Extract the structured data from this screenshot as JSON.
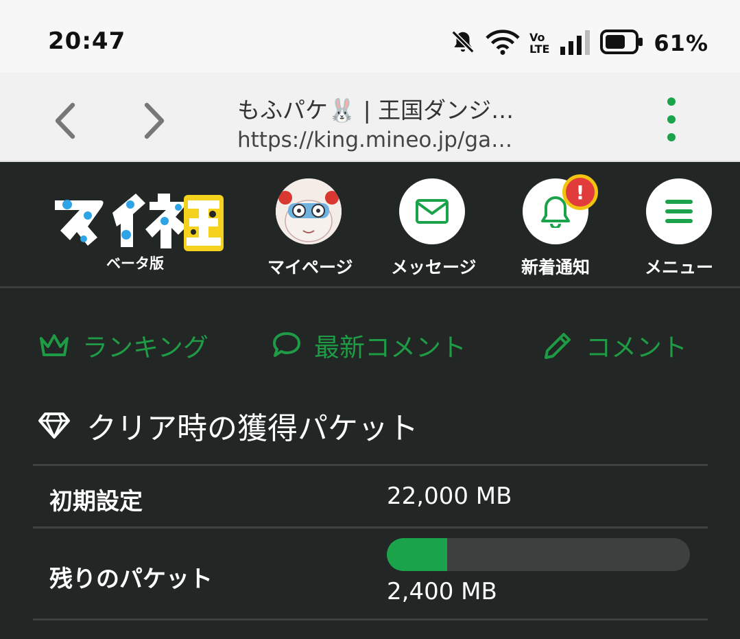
{
  "status_bar": {
    "time": "20:47",
    "volte_top": "Vo",
    "volte_bottom": "LTE",
    "battery_percent": "61%",
    "icons": [
      "bell-off-icon",
      "wifi-icon",
      "volte-icon",
      "signal-icon",
      "battery-icon"
    ]
  },
  "browser": {
    "tab_title": "もふパケ🐰 | 王国ダンジ…",
    "url": "https://king.mineo.jp/ga…",
    "icons": [
      "back-icon",
      "forward-icon",
      "more-menu-icon"
    ]
  },
  "header": {
    "logo_text": "マイネ王",
    "logo_sub": "ベータ版",
    "buttons": [
      {
        "label": "マイページ",
        "icon": "avatar"
      },
      {
        "label": "メッセージ",
        "icon": "mail-icon"
      },
      {
        "label": "新着通知",
        "icon": "bell-icon",
        "badge": "!"
      },
      {
        "label": "メニュー",
        "icon": "hamburger-icon"
      }
    ]
  },
  "links": {
    "ranking": "ランキング",
    "latest_comments": "最新コメント",
    "comment": "コメント"
  },
  "section": {
    "title": "クリア時の獲得パケット",
    "rows": [
      {
        "label": "初期設定",
        "value": "22,000 MB"
      },
      {
        "label": "残りのパケット",
        "value": "2,400 MB",
        "progress_fraction": 0.2
      }
    ]
  },
  "colors": {
    "accent_green": "#1aa34a",
    "background_dark": "#222624",
    "badge_red": "#e23b3b",
    "badge_border": "#f1c40f"
  }
}
